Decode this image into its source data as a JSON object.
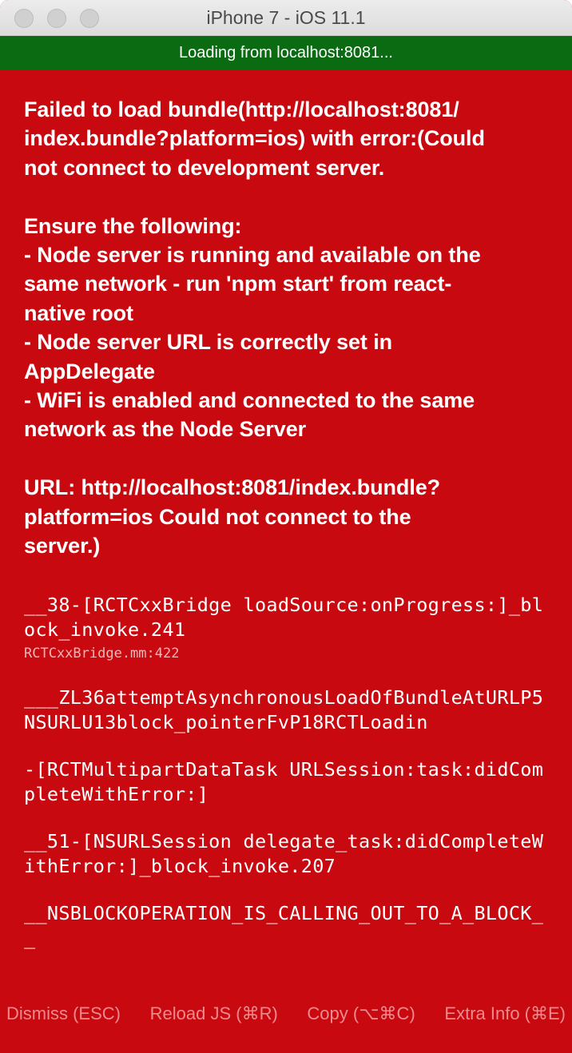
{
  "window": {
    "title": "iPhone 7 - iOS 11.1"
  },
  "loading_bar": {
    "text": "Loading from localhost:8081..."
  },
  "error": {
    "message": "Failed to load bundle(http://localhost:8081/\nindex.bundle?platform=ios) with error:(Could\nnot connect to development server.\n\nEnsure the following:\n- Node server is running and available on the\nsame network - run 'npm start' from react-\nnative root\n- Node server URL is correctly set in\nAppDelegate\n- WiFi is enabled and connected to the same\nnetwork as the Node Server\n\nURL: http://localhost:8081/index.bundle?\nplatform=ios Could not connect to the\nserver.)"
  },
  "stack": [
    {
      "method": "__38-[RCTCxxBridge loadSource:onProgress:]_block_invoke.241",
      "file": "RCTCxxBridge.mm:422"
    },
    {
      "method": "___ZL36attemptAsynchronousLoadOfBundleAtURLP5NSURLU13block_pointerFvP18RCTLoadin",
      "file": ""
    },
    {
      "method": "-[RCTMultipartDataTask URLSession:task:didCompleteWithError:]",
      "file": ""
    },
    {
      "method": "__51-[NSURLSession delegate_task:didCompleteWithError:]_block_invoke.207",
      "file": ""
    },
    {
      "method": "__NSBLOCKOPERATION_IS_CALLING_OUT_TO_A_BLOCK__",
      "file": ""
    }
  ],
  "buttons": {
    "dismiss": "Dismiss (ESC)",
    "reload": "Reload JS (⌘R)",
    "copy": "Copy (⌥⌘C)",
    "extra_info": "Extra Info (⌘E)"
  },
  "colors": {
    "background": "#c8090f",
    "loading_bar": "#0a6b12",
    "button_text": "#ee8a8e"
  }
}
